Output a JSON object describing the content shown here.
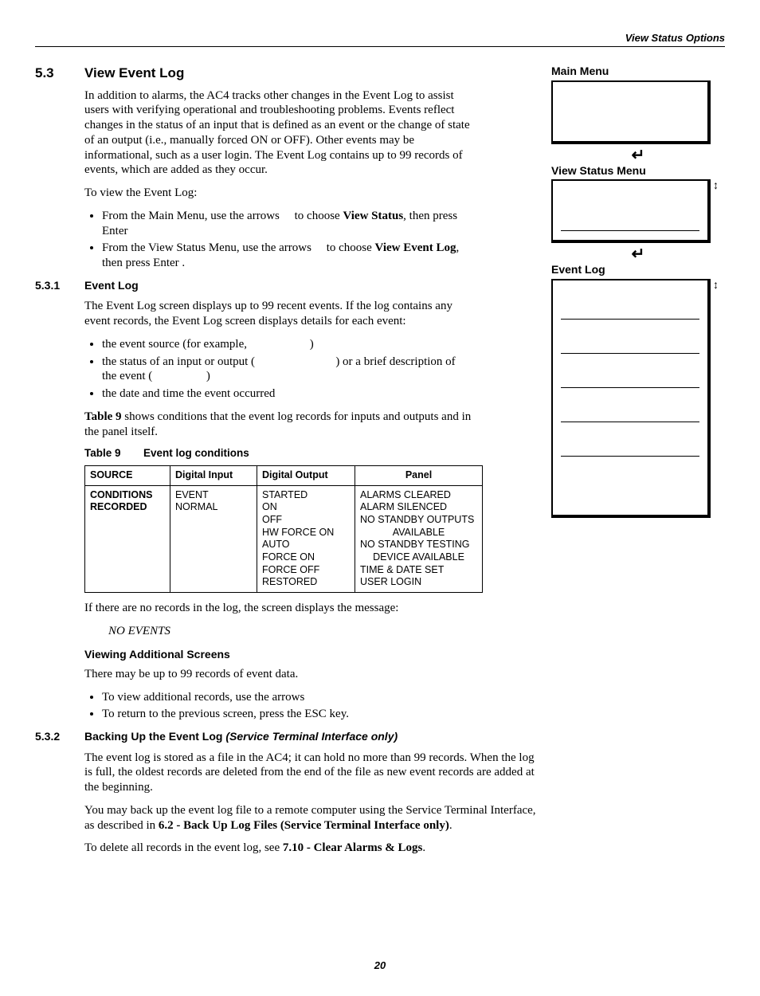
{
  "header": {
    "title": "View Status Options"
  },
  "section": {
    "num": "5.3",
    "title": "View Event Log",
    "intro_p1": "In addition to alarms, the AC4 tracks other changes in the Event Log to assist users with verifying operational and troubleshooting problems. Events reflect changes in the status of an input that is defined as an event or the change of state of an output (i.e., manually forced ON or OFF). Other events may be informational, such as a user login. The Event Log contains up to 99 records of events, which are added as they occur.",
    "intro_p2": "To view the Event Log:",
    "steps": {
      "s1a": "From the Main Menu, use the arrows",
      "s1b": "to choose ",
      "s1c": "View Status",
      "s1d": ", then press Enter",
      "s2a": "From the View Status Menu, use the arrows",
      "s2b": "to choose ",
      "s2c": "View Event Log",
      "s2d": ", then press Enter    ."
    }
  },
  "sub1": {
    "num": "5.3.1",
    "title": "Event Log",
    "p1": "The Event Log screen displays up to 99 recent events. If the log contains any event records, the Event Log screen displays details for each event:",
    "bullets": {
      "b1a": "the event source (for example,",
      "b1b": ")",
      "b2a": "the status of an input or output (",
      "b2b": ") or a brief description of the event (",
      "b2c": ")",
      "b3": "the date and time the event occurred"
    },
    "p2a": "Table 9",
    "p2b": " shows conditions that the event log records for inputs and outputs and in the panel itself.",
    "table": {
      "num": "Table 9",
      "caption": "Event log conditions",
      "h1": "SOURCE",
      "h2": "Digital Input",
      "h3": "Digital Output",
      "h4": "Panel",
      "r1c1a": "CONDITIONS",
      "r1c1b": "RECORDED",
      "r1c2": "EVENT\nNORMAL",
      "r1c3": "STARTED\nON\nOFF\nHW FORCE ON\nAUTO\nFORCE ON\nFORCE OFF\nRESTORED",
      "r1c4": "ALARMS CLEARED\nALARM SILENCED\nNO STANDBY OUTPUTS AVAILABLE\nNO STANDBY TESTING DEVICE AVAILABLE\nTIME & DATE SET\nUSER LOGIN"
    },
    "p3": "If there are no records in the log, the screen displays the message:",
    "noevents": "NO EVENTS",
    "viewing_h": "Viewing Additional Screens",
    "viewing_p": "There may be up to 99 records of event data.",
    "viewing_b1": "To view additional records, use the arrows",
    "viewing_b2": "To return to the previous screen, press the ESC key."
  },
  "sub2": {
    "num": "5.3.2",
    "title_a": "Backing Up the Event Log ",
    "title_b": "(Service Terminal Interface only)",
    "p1": "The event log is stored as a file in the AC4; it can hold no more than 99 records. When the log is full, the oldest records are deleted from the end of the file as new event records are added at the beginning.",
    "p2a": "You may back up the event log file to a remote computer using the Service Terminal Interface, as described in ",
    "p2b": "6.2 - Back Up Log Files (Service Terminal Interface only)",
    "p2c": ".",
    "p3a": "To delete all records in the event log, see ",
    "p3b": "7.10 - Clear Alarms & Logs",
    "p3c": "."
  },
  "right": {
    "label1": "Main Menu",
    "label2": "View Status Menu",
    "label3": "Event Log",
    "enter": "↵",
    "scroll": "↕"
  },
  "page": "20"
}
